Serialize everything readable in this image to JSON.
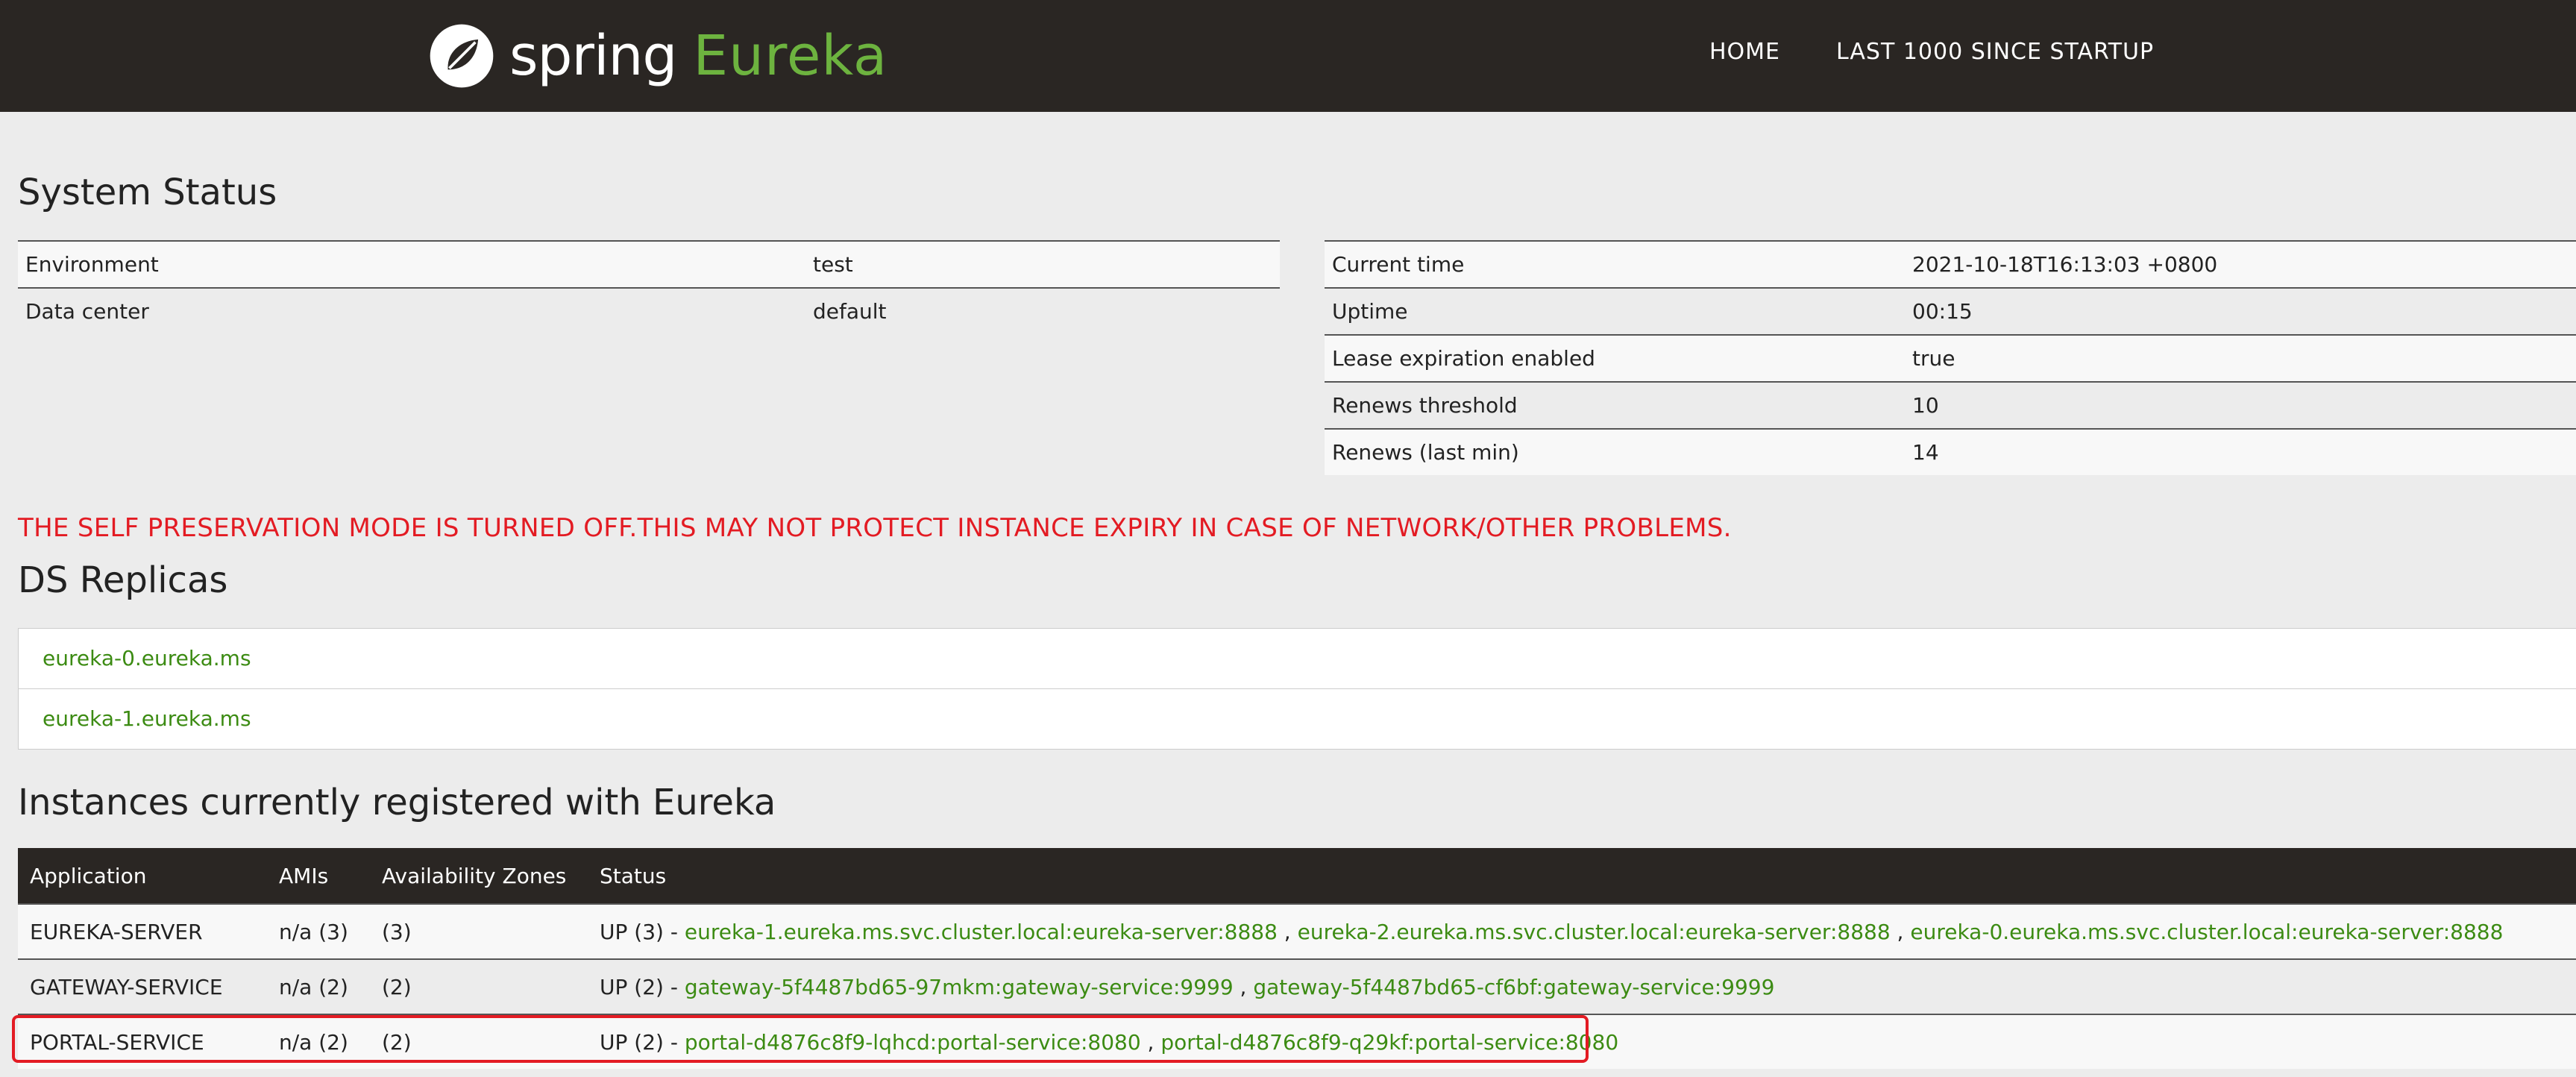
{
  "header": {
    "brand_spring": "spring",
    "brand_eureka": "Eureka",
    "nav": [
      "HOME",
      "LAST 1000 SINCE STARTUP"
    ]
  },
  "system_status": {
    "title": "System Status",
    "left": [
      {
        "key": "Environment",
        "value": "test"
      },
      {
        "key": "Data center",
        "value": "default"
      }
    ],
    "right": [
      {
        "key": "Current time",
        "value": "2021-10-18T16:13:03 +0800"
      },
      {
        "key": "Uptime",
        "value": "00:15"
      },
      {
        "key": "Lease expiration enabled",
        "value": "true"
      },
      {
        "key": "Renews threshold",
        "value": "10"
      },
      {
        "key": "Renews (last min)",
        "value": "14"
      }
    ]
  },
  "warning": "THE SELF PRESERVATION MODE IS TURNED OFF.THIS MAY NOT PROTECT INSTANCE EXPIRY IN CASE OF NETWORK/OTHER PROBLEMS.",
  "ds_replicas": {
    "title": "DS Replicas",
    "items": [
      "eureka-0.eureka.ms",
      "eureka-1.eureka.ms"
    ]
  },
  "instances": {
    "title": "Instances currently registered with Eureka",
    "columns": [
      "Application",
      "AMIs",
      "Availability Zones",
      "Status"
    ],
    "rows": [
      {
        "application": "EUREKA-SERVER",
        "amis": "n/a (3)",
        "zones": "(3)",
        "status_prefix": "UP (3) - ",
        "instances": [
          "eureka-1.eureka.ms.svc.cluster.local:eureka-server:8888",
          "eureka-2.eureka.ms.svc.cluster.local:eureka-server:8888",
          "eureka-0.eureka.ms.svc.cluster.local:eureka-server:8888"
        ]
      },
      {
        "application": "GATEWAY-SERVICE",
        "amis": "n/a (2)",
        "zones": "(2)",
        "status_prefix": "UP (2) - ",
        "instances": [
          "gateway-5f4487bd65-97mkm:gateway-service:9999",
          "gateway-5f4487bd65-cf6bf:gateway-service:9999"
        ]
      },
      {
        "application": "PORTAL-SERVICE",
        "amis": "n/a (2)",
        "zones": "(2)",
        "status_prefix": "UP (2) - ",
        "instances": [
          "portal-d4876c8f9-lqhcd:portal-service:8080",
          "portal-d4876c8f9-q29kf:portal-service:8080"
        ]
      }
    ]
  },
  "colors": {
    "header_bg": "#2a2623",
    "brand_green": "#6db33f",
    "link_green": "#3c8b13",
    "warning_red": "#e31b23",
    "page_bg": "#ececec"
  }
}
